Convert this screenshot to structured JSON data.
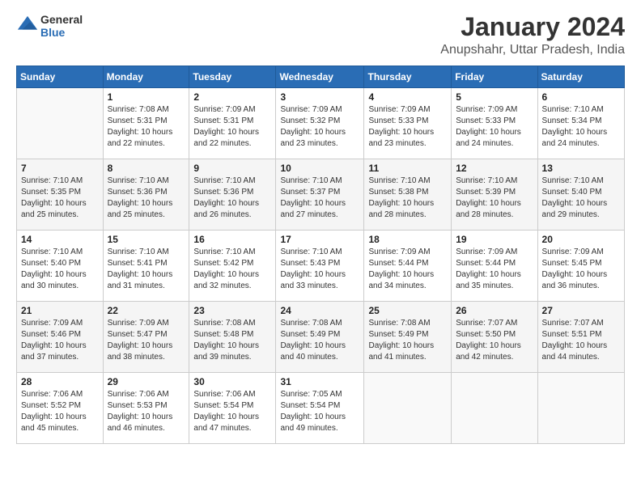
{
  "logo": {
    "line1": "General",
    "line2": "Blue"
  },
  "title": "January 2024",
  "location": "Anupshahr, Uttar Pradesh, India",
  "days_of_week": [
    "Sunday",
    "Monday",
    "Tuesday",
    "Wednesday",
    "Thursday",
    "Friday",
    "Saturday"
  ],
  "weeks": [
    [
      {
        "day": "",
        "info": ""
      },
      {
        "day": "1",
        "info": "Sunrise: 7:08 AM\nSunset: 5:31 PM\nDaylight: 10 hours\nand 22 minutes."
      },
      {
        "day": "2",
        "info": "Sunrise: 7:09 AM\nSunset: 5:31 PM\nDaylight: 10 hours\nand 22 minutes."
      },
      {
        "day": "3",
        "info": "Sunrise: 7:09 AM\nSunset: 5:32 PM\nDaylight: 10 hours\nand 23 minutes."
      },
      {
        "day": "4",
        "info": "Sunrise: 7:09 AM\nSunset: 5:33 PM\nDaylight: 10 hours\nand 23 minutes."
      },
      {
        "day": "5",
        "info": "Sunrise: 7:09 AM\nSunset: 5:33 PM\nDaylight: 10 hours\nand 24 minutes."
      },
      {
        "day": "6",
        "info": "Sunrise: 7:10 AM\nSunset: 5:34 PM\nDaylight: 10 hours\nand 24 minutes."
      }
    ],
    [
      {
        "day": "7",
        "info": "Sunrise: 7:10 AM\nSunset: 5:35 PM\nDaylight: 10 hours\nand 25 minutes."
      },
      {
        "day": "8",
        "info": "Sunrise: 7:10 AM\nSunset: 5:36 PM\nDaylight: 10 hours\nand 25 minutes."
      },
      {
        "day": "9",
        "info": "Sunrise: 7:10 AM\nSunset: 5:36 PM\nDaylight: 10 hours\nand 26 minutes."
      },
      {
        "day": "10",
        "info": "Sunrise: 7:10 AM\nSunset: 5:37 PM\nDaylight: 10 hours\nand 27 minutes."
      },
      {
        "day": "11",
        "info": "Sunrise: 7:10 AM\nSunset: 5:38 PM\nDaylight: 10 hours\nand 28 minutes."
      },
      {
        "day": "12",
        "info": "Sunrise: 7:10 AM\nSunset: 5:39 PM\nDaylight: 10 hours\nand 28 minutes."
      },
      {
        "day": "13",
        "info": "Sunrise: 7:10 AM\nSunset: 5:40 PM\nDaylight: 10 hours\nand 29 minutes."
      }
    ],
    [
      {
        "day": "14",
        "info": "Sunrise: 7:10 AM\nSunset: 5:40 PM\nDaylight: 10 hours\nand 30 minutes."
      },
      {
        "day": "15",
        "info": "Sunrise: 7:10 AM\nSunset: 5:41 PM\nDaylight: 10 hours\nand 31 minutes."
      },
      {
        "day": "16",
        "info": "Sunrise: 7:10 AM\nSunset: 5:42 PM\nDaylight: 10 hours\nand 32 minutes."
      },
      {
        "day": "17",
        "info": "Sunrise: 7:10 AM\nSunset: 5:43 PM\nDaylight: 10 hours\nand 33 minutes."
      },
      {
        "day": "18",
        "info": "Sunrise: 7:09 AM\nSunset: 5:44 PM\nDaylight: 10 hours\nand 34 minutes."
      },
      {
        "day": "19",
        "info": "Sunrise: 7:09 AM\nSunset: 5:44 PM\nDaylight: 10 hours\nand 35 minutes."
      },
      {
        "day": "20",
        "info": "Sunrise: 7:09 AM\nSunset: 5:45 PM\nDaylight: 10 hours\nand 36 minutes."
      }
    ],
    [
      {
        "day": "21",
        "info": "Sunrise: 7:09 AM\nSunset: 5:46 PM\nDaylight: 10 hours\nand 37 minutes."
      },
      {
        "day": "22",
        "info": "Sunrise: 7:09 AM\nSunset: 5:47 PM\nDaylight: 10 hours\nand 38 minutes."
      },
      {
        "day": "23",
        "info": "Sunrise: 7:08 AM\nSunset: 5:48 PM\nDaylight: 10 hours\nand 39 minutes."
      },
      {
        "day": "24",
        "info": "Sunrise: 7:08 AM\nSunset: 5:49 PM\nDaylight: 10 hours\nand 40 minutes."
      },
      {
        "day": "25",
        "info": "Sunrise: 7:08 AM\nSunset: 5:49 PM\nDaylight: 10 hours\nand 41 minutes."
      },
      {
        "day": "26",
        "info": "Sunrise: 7:07 AM\nSunset: 5:50 PM\nDaylight: 10 hours\nand 42 minutes."
      },
      {
        "day": "27",
        "info": "Sunrise: 7:07 AM\nSunset: 5:51 PM\nDaylight: 10 hours\nand 44 minutes."
      }
    ],
    [
      {
        "day": "28",
        "info": "Sunrise: 7:06 AM\nSunset: 5:52 PM\nDaylight: 10 hours\nand 45 minutes."
      },
      {
        "day": "29",
        "info": "Sunrise: 7:06 AM\nSunset: 5:53 PM\nDaylight: 10 hours\nand 46 minutes."
      },
      {
        "day": "30",
        "info": "Sunrise: 7:06 AM\nSunset: 5:54 PM\nDaylight: 10 hours\nand 47 minutes."
      },
      {
        "day": "31",
        "info": "Sunrise: 7:05 AM\nSunset: 5:54 PM\nDaylight: 10 hours\nand 49 minutes."
      },
      {
        "day": "",
        "info": ""
      },
      {
        "day": "",
        "info": ""
      },
      {
        "day": "",
        "info": ""
      }
    ]
  ]
}
